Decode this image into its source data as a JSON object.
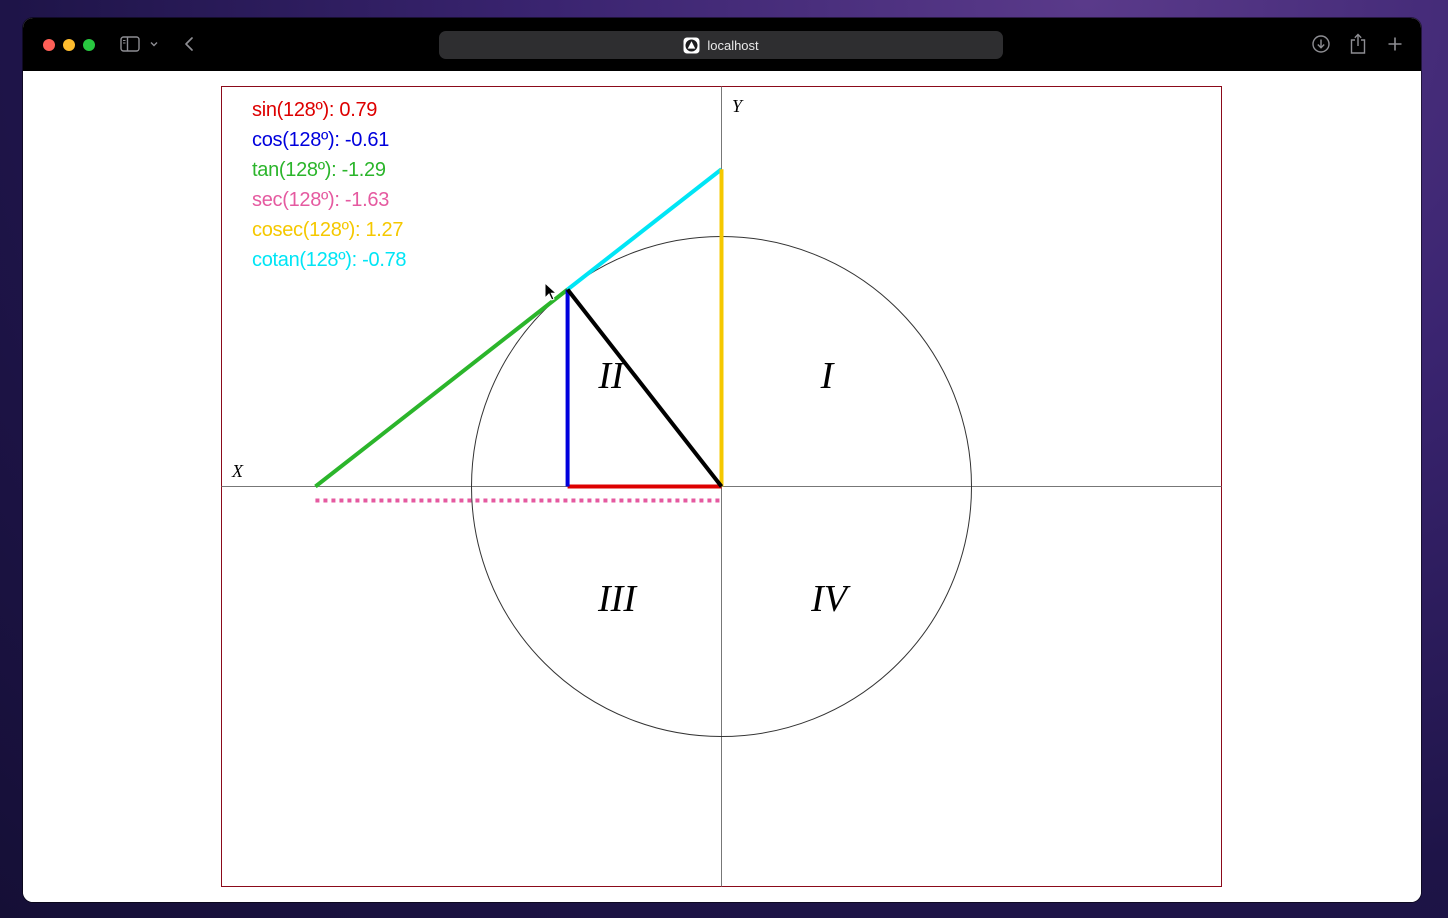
{
  "browser": {
    "address": "localhost",
    "icons": {
      "sidebar": "sidebar-icon",
      "chevron": "chevron-down-icon",
      "back": "back-arrow-icon",
      "site": "site-favicon-icon",
      "download": "download-icon",
      "share": "share-icon",
      "new_tab": "plus-icon"
    }
  },
  "axes": {
    "x_label": "X",
    "y_label": "Y"
  },
  "quadrants": {
    "q1": "I",
    "q2": "II",
    "q3": "III",
    "q4": "IV"
  },
  "angle_degrees": 128,
  "trig_values": [
    {
      "name": "sin",
      "text": "sin(128º): 0.79",
      "color": "#dd0000"
    },
    {
      "name": "cos",
      "text": "cos(128º): -0.61",
      "color": "#0000dd"
    },
    {
      "name": "tan",
      "text": "tan(128º): -1.29",
      "color": "#2bb52b"
    },
    {
      "name": "sec",
      "text": "sec(128º): -1.63",
      "color": "#e55aa0"
    },
    {
      "name": "cosec",
      "text": "cosec(128º): 1.27",
      "color": "#f5c800"
    },
    {
      "name": "cotan",
      "text": "cotan(128º): -0.78",
      "color": "#00e5f5"
    }
  ],
  "colors": {
    "frame_border": "#8b0a1a",
    "axis": "#777777",
    "circle": "#333333",
    "radius": "#000000"
  }
}
